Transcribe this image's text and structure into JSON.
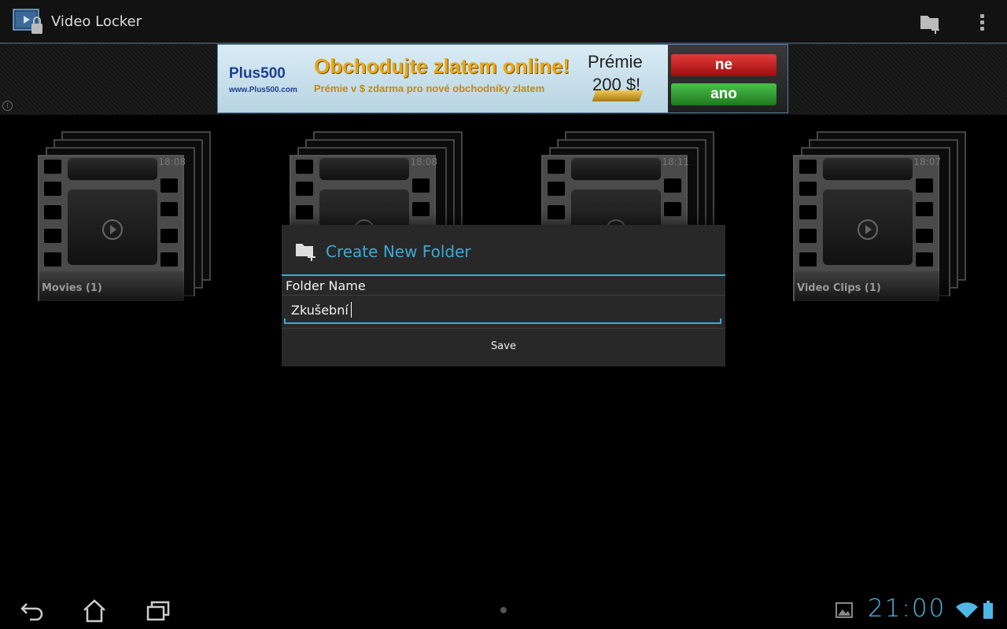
{
  "app": {
    "title": "Video Locker"
  },
  "actionbar": {
    "add_folder_icon": "folder-add-icon",
    "overflow_icon": "overflow-menu-icon"
  },
  "ad": {
    "logo": "Plus500",
    "url": "www.Plus500.com",
    "headline": "Obchodujte zlatem online!",
    "subline": "Prémie v $ zdarma pro nové obchodníky zlatem",
    "premium_line1": "Prémie",
    "premium_line2": "200 $!",
    "btn_no": "ne",
    "btn_yes": "ano"
  },
  "folders": [
    {
      "label": "Movies (1)",
      "time": "18:08"
    },
    {
      "label": "",
      "time": "18:08"
    },
    {
      "label": "",
      "time": "18:11"
    },
    {
      "label": "Video Clips (1)",
      "time": "18:07"
    }
  ],
  "dialog": {
    "title": "Create New Folder",
    "field_label": "Folder Name",
    "field_value": "Zkušební",
    "save_label": "Save"
  },
  "statusbar": {
    "time": "21:00"
  },
  "colors": {
    "accent": "#3fa8d6",
    "background": "#000000",
    "dialog_bg": "#282828"
  }
}
